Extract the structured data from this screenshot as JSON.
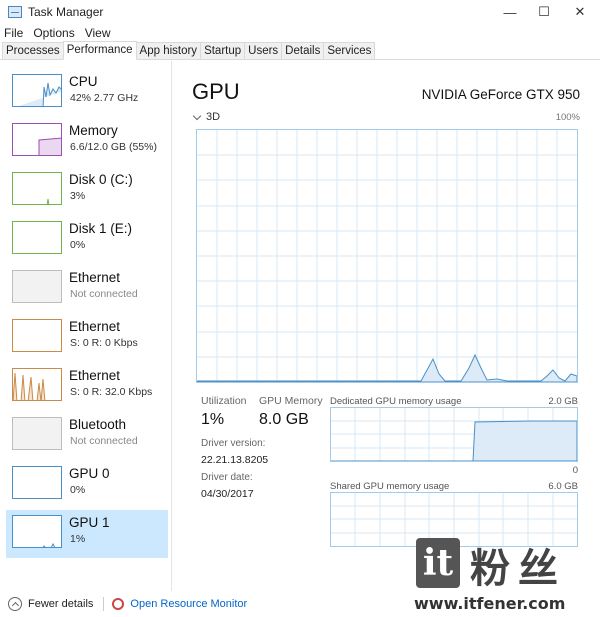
{
  "window": {
    "title": "Task Manager",
    "minimize": "—",
    "maximize": "☐",
    "close": "✕"
  },
  "menu": [
    "File",
    "Options",
    "View"
  ],
  "tabs": [
    "Processes",
    "Performance",
    "App history",
    "Startup",
    "Users",
    "Details",
    "Services"
  ],
  "active_tab": "Performance",
  "sidebar": {
    "items": [
      {
        "name": "CPU",
        "sub": "42%  2.77 GHz",
        "border": "#4a8fc8"
      },
      {
        "name": "Memory",
        "sub": "6.6/12.0 GB (55%)",
        "border": "#9d4fb5"
      },
      {
        "name": "Disk 0 (C:)",
        "sub": "3%",
        "border": "#6fb64a"
      },
      {
        "name": "Disk 1 (E:)",
        "sub": "0%",
        "border": "#6fb64a"
      },
      {
        "name": "Ethernet",
        "sub": "Not connected",
        "border": "#bdbdbd"
      },
      {
        "name": "Ethernet",
        "sub": "S: 0  R: 0 Kbps",
        "border": "#c98b4a"
      },
      {
        "name": "Ethernet",
        "sub": "S: 0  R: 32.0 Kbps",
        "border": "#c98b4a"
      },
      {
        "name": "Bluetooth",
        "sub": "Not connected",
        "border": "#bdbdbd"
      },
      {
        "name": "GPU 0",
        "sub": "0%",
        "border": "#4a8fc8"
      },
      {
        "name": "GPU 1",
        "sub": "1%",
        "border": "#4a8fc8"
      }
    ],
    "selected_index": 9
  },
  "main": {
    "title": "GPU",
    "model": "NVIDIA GeForce GTX 950",
    "engine": "3D",
    "max_pct": "100%",
    "utilization_label": "Utilization",
    "utilization_value": "1%",
    "gpu_memory_label": "GPU Memory",
    "gpu_memory_value": "8.0 GB",
    "driver_version_label": "Driver version:",
    "driver_version_value": "22.21.13.8205",
    "driver_date_label": "Driver date:",
    "driver_date_value": "04/30/2017",
    "dedicated_label": "Dedicated GPU memory usage",
    "dedicated_max": "2.0 GB",
    "dedicated_min": "0",
    "shared_label": "Shared GPU memory usage",
    "shared_max": "6.0 GB"
  },
  "footer": {
    "fewer_details": "Fewer details",
    "open_monitor": "Open Resource Monitor"
  },
  "watermark": {
    "logo_letter": "it",
    "chinese": "粉丝",
    "url": "www.itfener.com"
  },
  "colors": {
    "accent": "#4a8fc8",
    "selected_bg": "#cce8ff",
    "graph_border": "#a6cbe8",
    "graph_grid": "#d6e8f6",
    "graph_fill": "#dcebf7",
    "link": "#0066cc"
  }
}
